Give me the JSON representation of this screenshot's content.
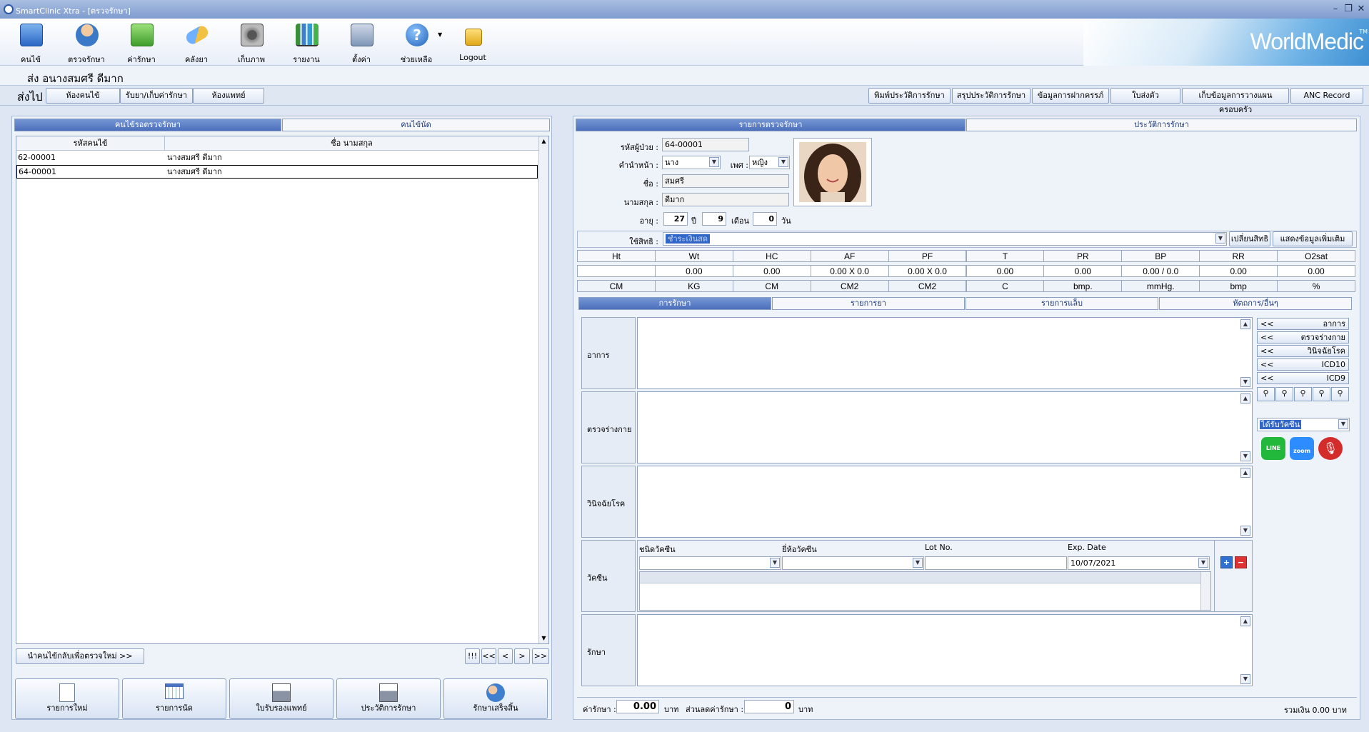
{
  "window": {
    "title": "SmartClinic Xtra - [ตรวจรักษา]"
  },
  "toolbar": {
    "items": [
      {
        "label": "คนไข้",
        "icon": "patient-book-icon"
      },
      {
        "label": "ตรวจรักษา",
        "icon": "doctor-icon"
      },
      {
        "label": "ค่ารักษา",
        "icon": "money-icon"
      },
      {
        "label": "คลังยา",
        "icon": "pill-icon"
      },
      {
        "label": "เก็บภาพ",
        "icon": "camera-icon"
      },
      {
        "label": "รายงาน",
        "icon": "bar-chart-icon"
      },
      {
        "label": "ตั้งค่า",
        "icon": "settings-tools-icon"
      },
      {
        "label": "ช่วยเหลือ",
        "icon": "help-icon"
      },
      {
        "label": "Logout",
        "icon": "lock-icon"
      }
    ],
    "brand": "WorldMedic",
    "brand_tm": "TM"
  },
  "patient_header": {
    "name": "ส่ง  อนางสมศรี ดีมาก"
  },
  "send_bar": {
    "label": "ส่งไป",
    "buttons": [
      "ห้องคนไข้",
      "รับยา/เก็บค่ารักษา",
      "ห้องแพทย์"
    ],
    "right_buttons": [
      "พิมพ์ประวัติการรักษา",
      "สรุปประวัติการรักษา",
      "ข้อมูลการฝากครรภ์",
      "ใบส่งตัว",
      "เก็บข้อมูลการวางแผนครอบครัว",
      "ANC Record"
    ]
  },
  "left": {
    "tabs": [
      "คนไข้รอตรวจรักษา",
      "คนไข้นัด"
    ],
    "columns": [
      "รหัสคนไข้",
      "ชื่อ นามสกุล"
    ],
    "rows": [
      {
        "id": "62-00001",
        "name": "นางสมศรี ดีมาก"
      },
      {
        "id": "64-00001",
        "name": "นางสมศรี ดีมาก"
      }
    ],
    "recall_button": "นำคนไข้กลับเพื่อตรวจใหม่ >>",
    "nav": [
      "!!!",
      "<<",
      "<",
      ">",
      ">>"
    ],
    "bottom_buttons": [
      {
        "label": "รายการใหม่",
        "icon": "new-document-icon"
      },
      {
        "label": "รายการนัด",
        "icon": "calendar-icon"
      },
      {
        "label": "ใบรับรองแพทย์",
        "icon": "printer-icon"
      },
      {
        "label": "ประวัติการรักษา",
        "icon": "printer-check-icon"
      },
      {
        "label": "รักษาเสร็จสิ้น",
        "icon": "users-check-icon"
      }
    ]
  },
  "right": {
    "tabs": [
      "รายการตรวจรักษา",
      "ประวัติการรักษา"
    ],
    "patient": {
      "id_label": "รหัสผู้ป่วย :",
      "id": "64-00001",
      "prefix_label": "คำนำหน้า :",
      "prefix": "นาง",
      "sex_label": "เพศ :",
      "sex": "หญิง",
      "first_label": "ชื่อ :",
      "first": "สมศรี",
      "last_label": "นามสกุล :",
      "last": "ดีมาก",
      "age_label": "อายุ :",
      "age_y": "27",
      "y_label": "ปี",
      "age_m": "9",
      "m_label": "เดือน",
      "age_d": "0",
      "d_label": "วัน"
    },
    "rights_label": "ใช้สิทธิ :",
    "rights_value": "ชำระเงินสด",
    "rights_buttons": [
      "เปลี่ยนสิทธิ",
      "แสดงข้อมูลเพิ่มเติม"
    ],
    "vitals": {
      "headers": [
        "Ht",
        "Wt",
        "HC",
        "AF",
        "PF",
        "T",
        "PR",
        "BP",
        "RR",
        "O2sat"
      ],
      "values": [
        "",
        "0.00",
        "0.00",
        "0.00 X 0.0",
        "0.00 X 0.0",
        "0.00",
        "0.00",
        "0.00 / 0.0",
        "0.00",
        "0.00"
      ],
      "units": [
        "CM",
        "KG",
        "CM",
        "CM2",
        "CM2",
        "C",
        "bmp.",
        "mmHg.",
        "bmp",
        "%"
      ]
    },
    "subtabs": [
      "การรักษา",
      "รายการยา",
      "รายการแล็บ",
      "หัตถการ/อื่นๆ"
    ],
    "sections": {
      "symptom": "อาการ",
      "exam": "ตรวจร่างกาย",
      "diagnosis": "วินิจฉัยโรค",
      "vaccine": "วัคซีน",
      "treatment": "รักษา"
    },
    "vaccine": {
      "cols": [
        "ชนิดวัคซีน",
        "ยี่ห้อวัคซีน",
        "Lot No.",
        "Exp. Date"
      ],
      "exp_date": "10/07/2021"
    },
    "side_buttons": [
      "อาการ",
      "ตรวจร่างกาย",
      "วินิจฉัยโรค",
      "ICD10",
      "ICD9"
    ],
    "side_prefix": "<<",
    "vaccine_combo": "ได้รับวัคซีน",
    "footer": {
      "fee_label": "ค่ารักษา :",
      "fee": "0.00",
      "baht": "บาท",
      "discount_label": "ส่วนลดค่ารักษา :",
      "discount": "0",
      "total": "รวมเงิน 0.00 บาท"
    }
  },
  "colors": {
    "accent": "#4c6fbc",
    "line_green": "#21b83c",
    "zoom_blue": "#2d8cff",
    "mic_red": "#d42b2b"
  }
}
